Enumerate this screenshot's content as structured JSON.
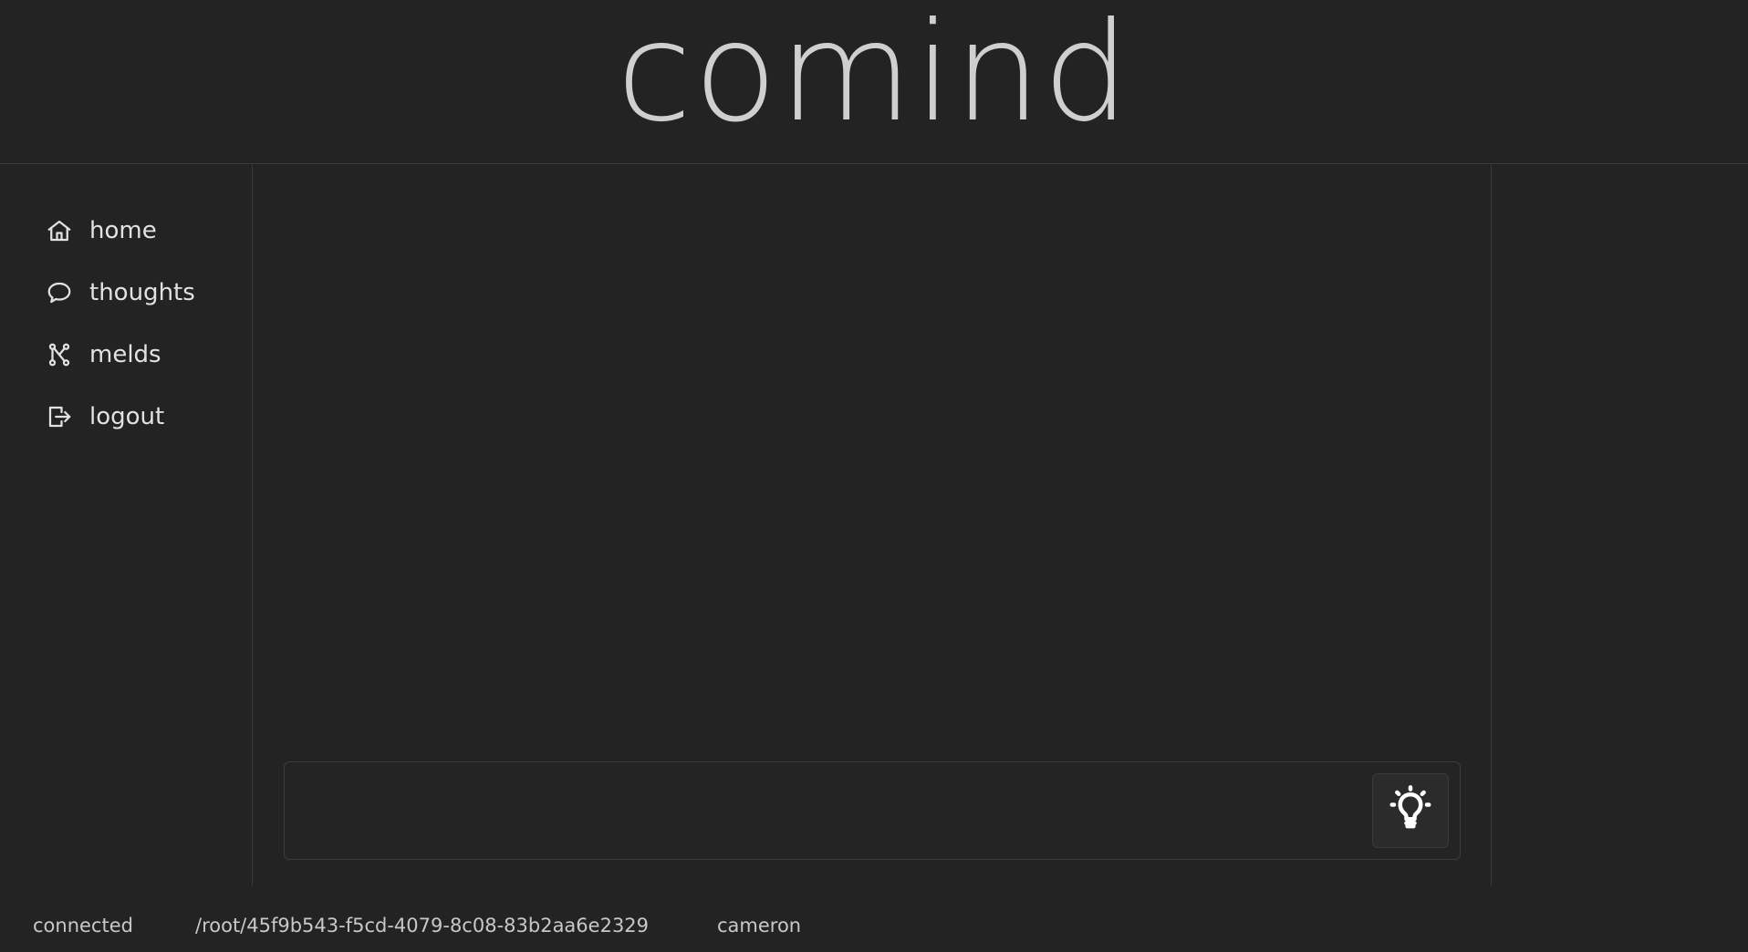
{
  "app": {
    "title": "comind"
  },
  "sidebar": {
    "items": [
      {
        "label": "home",
        "icon": "home-icon"
      },
      {
        "label": "thoughts",
        "icon": "speech-bubble-icon"
      },
      {
        "label": "melds",
        "icon": "graph-nodes-icon"
      },
      {
        "label": "logout",
        "icon": "logout-icon"
      }
    ]
  },
  "composer": {
    "value": "",
    "placeholder": "",
    "submit_icon": "lightbulb-icon"
  },
  "status": {
    "connection": "connected",
    "path": "/root/45f9b543-f5cd-4079-8c08-83b2aa6e2329",
    "user": "cameron"
  },
  "colors": {
    "background": "#232323",
    "border": "#3a3a3a",
    "text": "#e2e2e2",
    "title": "#cfcfcf"
  }
}
